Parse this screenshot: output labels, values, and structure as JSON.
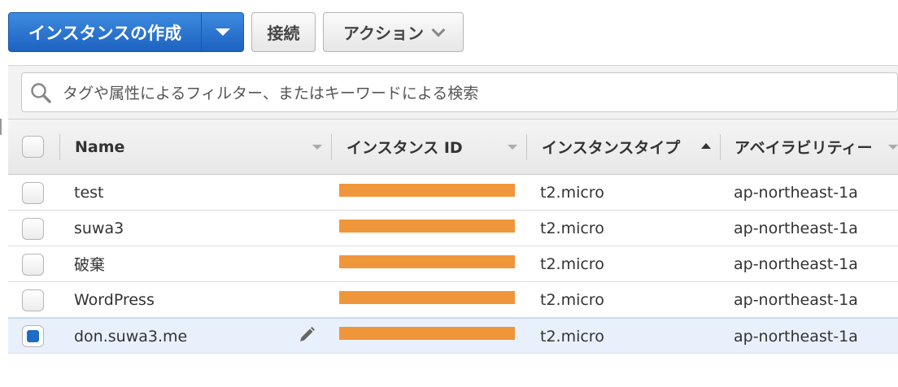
{
  "toolbar": {
    "launch_label": "インスタンスの作成",
    "connect_label": "接続",
    "actions_label": "アクション"
  },
  "search": {
    "placeholder": "タグや属性によるフィルター、またはキーワードによる検索"
  },
  "table": {
    "columns": [
      "Name",
      "インスタンス ID",
      "インスタンスタイプ",
      "アベイラビリティー"
    ],
    "sorted_column": "インスタンスタイプ",
    "sort_direction": "ascending",
    "rows": [
      {
        "name": "test",
        "instance_id": "[redacted]",
        "type": "t2.micro",
        "az": "ap-northeast-1a",
        "selected": false
      },
      {
        "name": "suwa3",
        "instance_id": "[redacted]",
        "type": "t2.micro",
        "az": "ap-northeast-1a",
        "selected": false
      },
      {
        "name": "破棄",
        "instance_id": "[redacted]",
        "type": "t2.micro",
        "az": "ap-northeast-1a",
        "selected": false
      },
      {
        "name": "WordPress",
        "instance_id": "[redacted]",
        "type": "t2.micro",
        "az": "ap-northeast-1a",
        "selected": false
      },
      {
        "name": "don.suwa3.me",
        "instance_id": "[redacted]",
        "type": "t2.micro",
        "az": "ap-northeast-1a",
        "selected": true
      }
    ]
  },
  "colors": {
    "primary": "#1d62c0",
    "redaction": "#f0963a",
    "selected_row": "#e8f1fb"
  }
}
